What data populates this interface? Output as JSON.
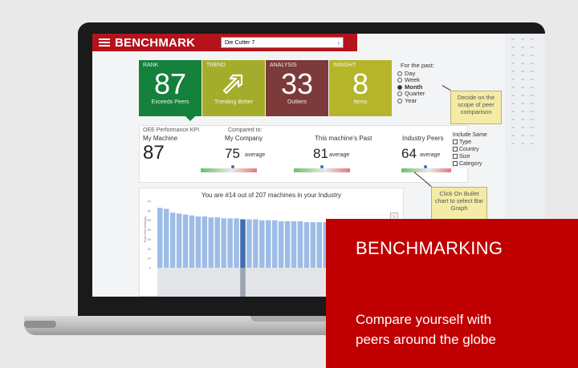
{
  "header": {
    "brand": "BENCHMARK",
    "machine_select": "Die Cutter 7"
  },
  "tiles": {
    "rank": {
      "label": "RANK",
      "value": "87",
      "sub": "Exceeds Peers"
    },
    "trend": {
      "label": "TREND",
      "icon": "arrow-up-right-icon",
      "sub": "Trending Better"
    },
    "analysis": {
      "label": "ANALYSIS",
      "value": "33",
      "sub": "Outliers"
    },
    "insight": {
      "label": "INSIGHT",
      "value": "8",
      "sub": "Items"
    }
  },
  "period": {
    "title": "For the past:",
    "options": [
      "Day",
      "Week",
      "Month",
      "Quarter",
      "Year"
    ],
    "selected": "Month"
  },
  "kpi": {
    "title": "OEE Performance KPI",
    "compared_to": "Compared to:",
    "my_machine": {
      "label": "My Machine",
      "value": "87"
    },
    "my_company": {
      "label": "My Company",
      "value": "75",
      "avg": "average"
    },
    "past": {
      "label": "This machine's Past",
      "value": "81",
      "avg": "average"
    },
    "industry": {
      "label": "Industry Peers",
      "value": "64",
      "avg": "average"
    }
  },
  "include": {
    "title": "Include Same",
    "items": [
      "Type",
      "Country",
      "Size",
      "Category"
    ]
  },
  "chart": {
    "title": "You are #14 out of 207 machines in your Industry",
    "ylabel": "Rate (Percentage)"
  },
  "chart_data": {
    "type": "bar",
    "title": "You are #14 out of 207 machines in your Industry",
    "ylabel": "Rate (Percentage)",
    "ylim": [
      0,
      70
    ],
    "y_ticks": [
      0,
      10,
      20,
      30,
      40,
      50,
      60,
      70
    ],
    "values": [
      63,
      62,
      58,
      57,
      56,
      55,
      54,
      54,
      53,
      53,
      52,
      52,
      52,
      51,
      51,
      51,
      50,
      50,
      50,
      49,
      49,
      49,
      49,
      48,
      48,
      48,
      48,
      47,
      47,
      47,
      47,
      46,
      46,
      46
    ],
    "highlight_index": 13,
    "colors": {
      "bar": "#9dbde6",
      "highlight": "#3f6fae"
    }
  },
  "callouts": {
    "scope": "Decide on the scope of peer comparison",
    "bullet": "Click On Bullet chart to select Bar Graph"
  },
  "banner": {
    "title": "BENCHMARKING",
    "line1": "Compare yourself with",
    "line2": "peers around the globe"
  }
}
